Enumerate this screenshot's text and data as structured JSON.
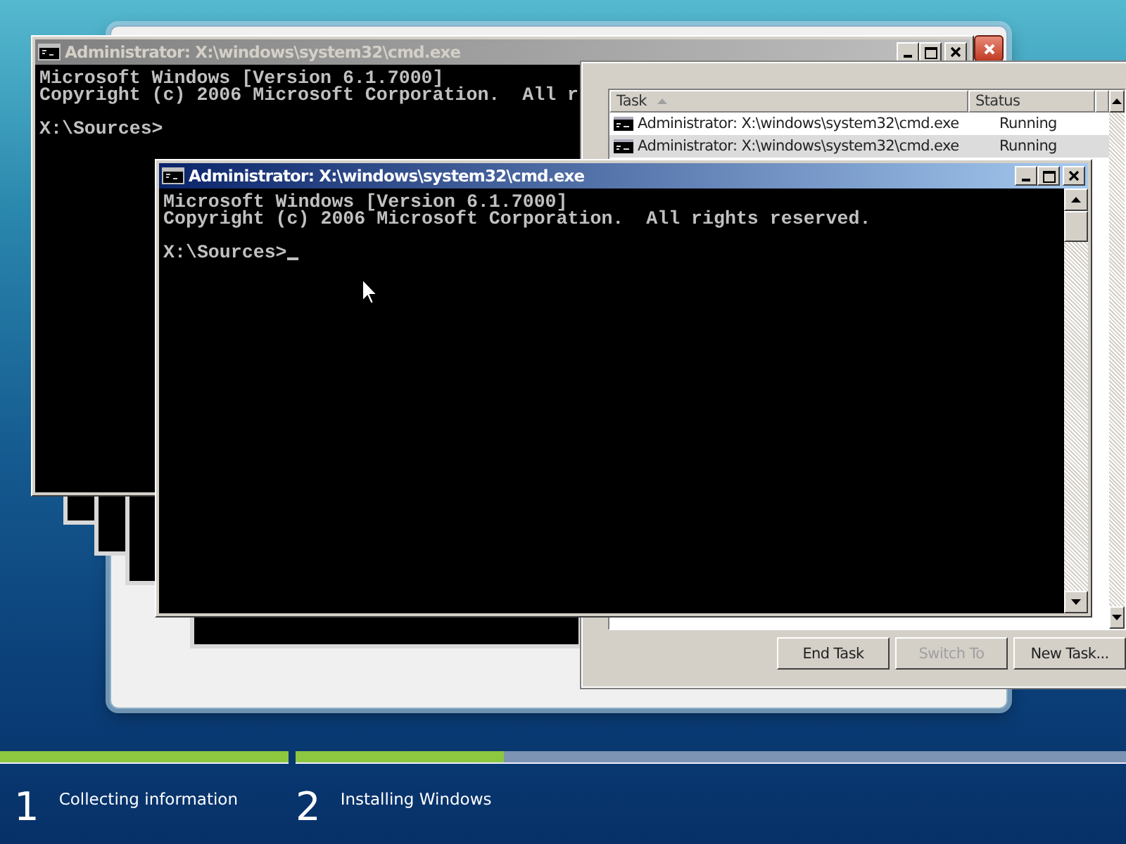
{
  "back_console": {
    "title": "Administrator: X:\\windows\\system32\\cmd.exe",
    "active": false,
    "lines": [
      "Microsoft Windows [Version 6.1.7000]",
      "Copyright (c) 2006 Microsoft Corporation.  All r"
    ],
    "prompt": "X:\\Sources>"
  },
  "task_manager": {
    "columns": [
      "Task",
      "Status"
    ],
    "rows": [
      {
        "task": "Administrator: X:\\windows\\system32\\cmd.exe",
        "status": "Running",
        "selected": false
      },
      {
        "task": "Administrator: X:\\windows\\system32\\cmd.exe",
        "status": "Running",
        "selected": true
      }
    ],
    "buttons": [
      {
        "label": "End Task",
        "disabled": false
      },
      {
        "label": "Switch To",
        "disabled": true
      },
      {
        "label": "New Task...",
        "disabled": false
      }
    ]
  },
  "front_console": {
    "title": "Administrator: X:\\windows\\system32\\cmd.exe",
    "active": true,
    "lines": [
      "Microsoft Windows [Version 6.1.7000]",
      "Copyright (c) 2006 Microsoft Corporation.  All rights reserved."
    ],
    "prompt": "X:\\Sources>",
    "cursor": true
  },
  "progress": {
    "steps": [
      {
        "number": "1",
        "label": "Collecting information",
        "level": 1
      },
      {
        "number": "2",
        "label": "Installing Windows",
        "level": 0.25
      }
    ]
  }
}
